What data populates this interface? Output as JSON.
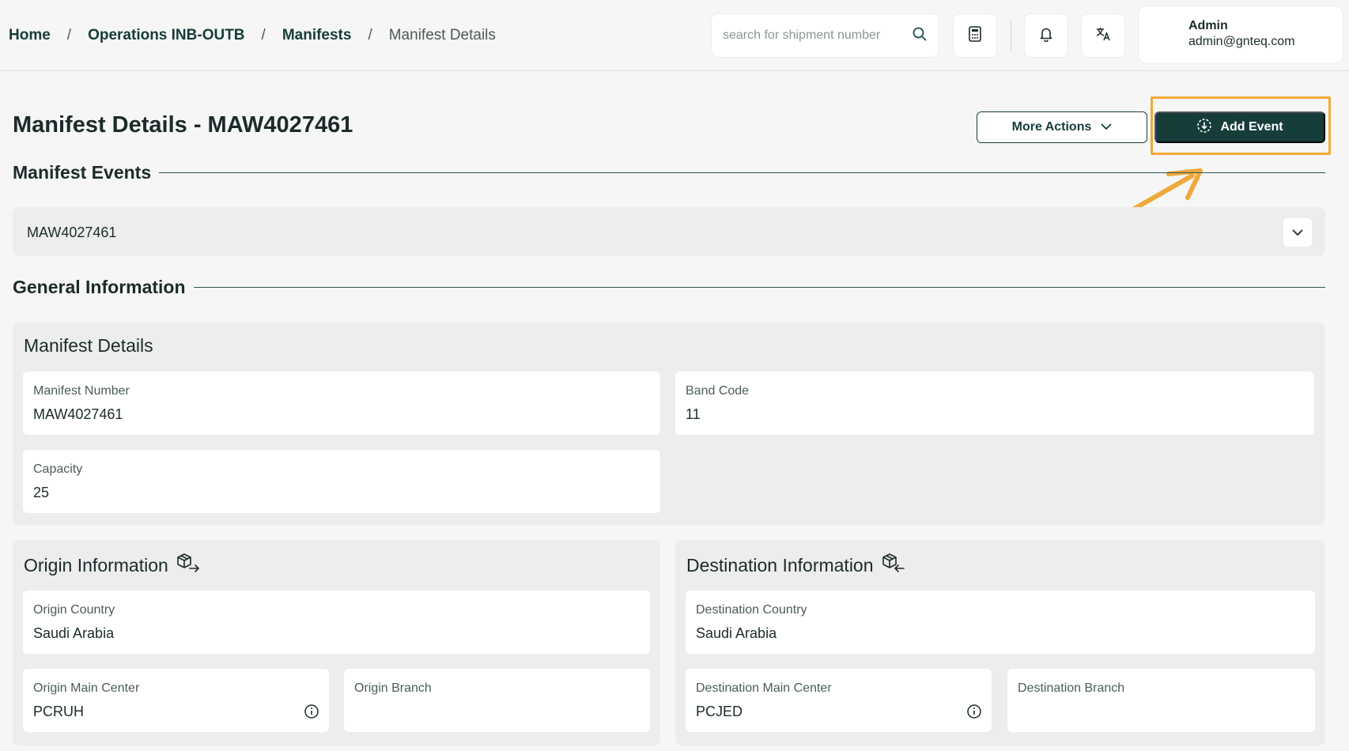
{
  "breadcrumb": [
    {
      "label": "Home"
    },
    {
      "label": "Operations INB-OUTB"
    },
    {
      "label": "Manifests"
    },
    {
      "label": "Manifest Details"
    }
  ],
  "breadcrumb_separator": "/",
  "search": {
    "placeholder": "search for shipment number"
  },
  "user": {
    "name": "Admin",
    "email": "admin@gnteq.com"
  },
  "page": {
    "title": "Manifest Details - MAW4027461"
  },
  "actions": {
    "more_actions_label": "More Actions",
    "add_event_label": "Add Event"
  },
  "annotation": {
    "color": "#f0a83a"
  },
  "manifest_events": {
    "section_title": "Manifest Events",
    "selected": "MAW4027461"
  },
  "general": {
    "section_title": "General Information",
    "manifest_details": {
      "title": "Manifest Details",
      "fields": [
        {
          "label": "Manifest Number",
          "value": "MAW4027461"
        },
        {
          "label": "Band Code",
          "value": "11"
        },
        {
          "label": "Capacity",
          "value": "25"
        }
      ]
    },
    "origin": {
      "title": "Origin Information",
      "icon": "package-out-icon",
      "country": {
        "label": "Origin Country",
        "value": "Saudi Arabia"
      },
      "main_center": {
        "label": "Origin Main Center",
        "value": "PCRUH"
      },
      "branch": {
        "label": "Origin Branch",
        "value": ""
      }
    },
    "destination": {
      "title": "Destination Information",
      "icon": "package-in-icon",
      "country": {
        "label": "Destination Country",
        "value": "Saudi Arabia"
      },
      "main_center": {
        "label": "Destination Main Center",
        "value": "PCJED"
      },
      "branch": {
        "label": "Destination Branch",
        "value": ""
      }
    }
  },
  "colors": {
    "primary": "#173d3b",
    "background": "#f5f6f5",
    "panel": "#ededed"
  }
}
